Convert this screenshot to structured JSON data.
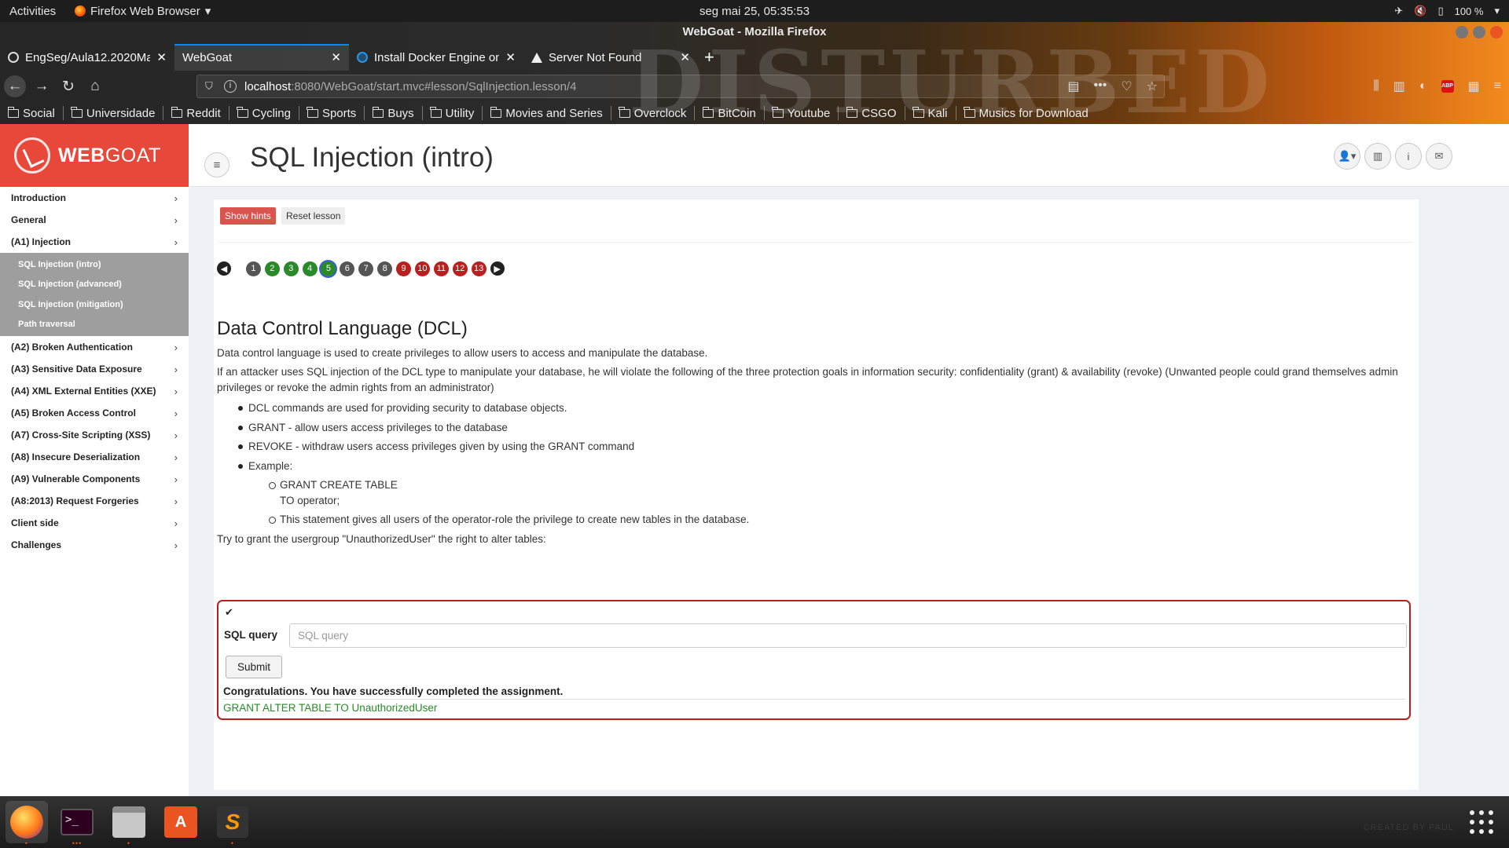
{
  "system_bar": {
    "activities": "Activities",
    "app_name": "Firefox Web Browser",
    "datetime": "seg mai 25, 05:35:53",
    "battery": "100 %"
  },
  "window": {
    "title": "WebGoat - Mozilla Firefox"
  },
  "tabs": [
    {
      "label": "EngSeg/Aula12.2020Ma",
      "icon": "github-icon",
      "active": false
    },
    {
      "label": "WebGoat",
      "icon": "none",
      "active": true
    },
    {
      "label": "Install Docker Engine on",
      "icon": "docker-icon",
      "active": false
    },
    {
      "label": "Server Not Found",
      "icon": "warning-icon",
      "active": false
    }
  ],
  "url": {
    "host": "localhost",
    "path": ":8080/WebGoat/start.mvc#lesson/SqlInjection.lesson/4"
  },
  "bookmarks": [
    "Social",
    "Universidade",
    "Reddit",
    "Cycling",
    "Sports",
    "Buys",
    "Utility",
    "Movies and Series",
    "Overclock",
    "BitCoin",
    "Youtube",
    "CSGO",
    "Kali",
    "Musics for Download"
  ],
  "theme_text": "DISTURBED",
  "sidebar": {
    "brand_prefix": "WEB",
    "brand_suffix": "GOAT",
    "items_top": [
      "Introduction",
      "General",
      "(A1) Injection"
    ],
    "subitems": [
      "SQL Injection (intro)",
      "SQL Injection (advanced)",
      "SQL Injection (mitigation)",
      "Path traversal"
    ],
    "items_bottom": [
      "(A2) Broken Authentication",
      "(A3) Sensitive Data Exposure",
      "(A4) XML External Entities (XXE)",
      "(A5) Broken Access Control",
      "(A7) Cross-Site Scripting (XSS)",
      "(A8) Insecure Deserialization",
      "(A9) Vulnerable Components",
      "(A8:2013) Request Forgeries",
      "Client side",
      "Challenges"
    ]
  },
  "header": {
    "title": "SQL Injection (intro)"
  },
  "lesson": {
    "show_hints": "Show hints",
    "reset_lesson": "Reset lesson",
    "pages": [
      {
        "n": "1",
        "status": "grey"
      },
      {
        "n": "2",
        "status": "green"
      },
      {
        "n": "3",
        "status": "green"
      },
      {
        "n": "4",
        "status": "green"
      },
      {
        "n": "5",
        "status": "green",
        "current": true
      },
      {
        "n": "6",
        "status": "grey"
      },
      {
        "n": "7",
        "status": "grey"
      },
      {
        "n": "8",
        "status": "grey"
      },
      {
        "n": "9",
        "status": "red"
      },
      {
        "n": "10",
        "status": "red"
      },
      {
        "n": "11",
        "status": "red"
      },
      {
        "n": "12",
        "status": "red"
      },
      {
        "n": "13",
        "status": "red"
      }
    ],
    "heading": "Data Control Language (DCL)",
    "intro": "Data control language is used to create privileges to allow users to access and manipulate the database.",
    "paragraph": "If an attacker uses SQL injection of the DCL type to manipulate your database, he will violate the following of the three protection goals in information security: confidentiality (grant) & availability (revoke) (Unwanted people could grand themselves admin privileges or revoke the admin rights from an administrator)",
    "bullets": [
      "DCL commands are used for providing security to database objects.",
      "GRANT - allow users access privileges to the database",
      "REVOKE - withdraw users access privileges given by using the GRANT command",
      "Example:"
    ],
    "example_line1": "GRANT CREATE TABLE",
    "example_line2": "TO operator;",
    "example_note": "This statement gives all users of the operator-role the privilege to create new tables in the database.",
    "task": "Try to grant the usergroup \"UnauthorizedUser\" the right to alter tables:"
  },
  "assignment": {
    "label": "SQL query",
    "placeholder": "SQL query",
    "submit": "Submit",
    "feedback": "Congratulations. You have successfully completed the assignment.",
    "output": "GRANT ALTER TABLE TO UnauthorizedUser"
  },
  "dock": {
    "apps": [
      "firefox-icon",
      "terminal-icon",
      "files-icon",
      "software-center-icon",
      "sublime-text-icon"
    ],
    "watermark": "CREATED BY PAUL"
  },
  "colors": {
    "brand_red": "#e8483a",
    "page_green": "#2a8a2a",
    "page_red": "#b81f1f",
    "page_grey": "#555555",
    "ubuntu_orange": "#e95420"
  }
}
